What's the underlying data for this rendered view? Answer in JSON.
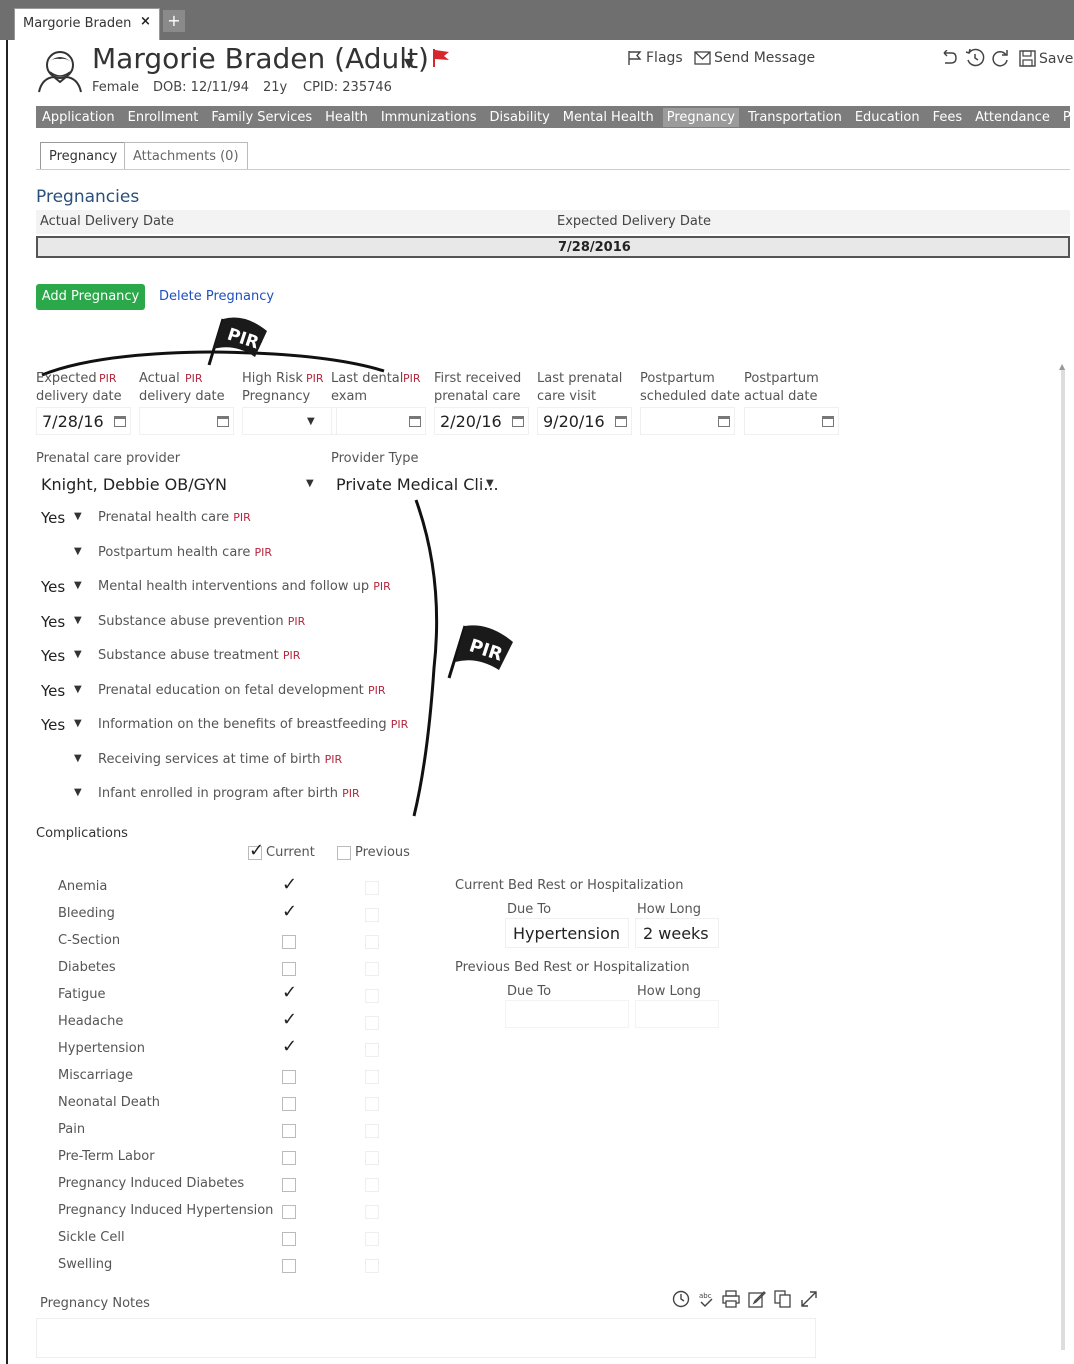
{
  "window_tab": {
    "title": "Margorie Braden",
    "close": "×",
    "add": "+"
  },
  "header": {
    "name": "Margorie Braden (Adult)",
    "gender": "Female",
    "dob": "DOB: 12/11/94",
    "age": "21y",
    "cpid": "CPID: 235746",
    "flags_label": "Flags",
    "send_message_label": "Send Message",
    "save_label": "Save",
    "flag_color": "#d7262e"
  },
  "module_nav": [
    "Application",
    "Enrollment",
    "Family Services",
    "Health",
    "Immunizations",
    "Disability",
    "Mental Health",
    "Pregnancy",
    "Transportation",
    "Education",
    "Fees",
    "Attendance",
    "PIR"
  ],
  "module_nav_active": "Pregnancy",
  "subtabs": [
    "Pregnancy",
    "Attachments (0)"
  ],
  "pregnancies": {
    "title": "Pregnancies",
    "col_actual": "Actual Delivery Date",
    "col_expected": "Expected Delivery Date",
    "row_actual": "",
    "row_expected": "7/28/2016"
  },
  "buttons": {
    "add": "Add Pregnancy",
    "delete": "Delete Pregnancy"
  },
  "pir_tag": "PIR",
  "pir_badge": "PIR",
  "fields": {
    "expected_delivery": {
      "l1": "Expected",
      "l2": "delivery date",
      "value": "7/28/16"
    },
    "actual_delivery": {
      "l1": "Actual",
      "l2": "delivery date",
      "value": ""
    },
    "high_risk": {
      "l1": "High Risk",
      "l2": "Pregnancy",
      "value": ""
    },
    "last_dental": {
      "l1": "Last dental",
      "l2": "exam",
      "value": ""
    },
    "first_prenatal": {
      "l1": "First received",
      "l2": "prenatal care",
      "value": "2/20/16"
    },
    "last_prenatal": {
      "l1": "Last prenatal",
      "l2": "care visit",
      "value": "9/20/16"
    },
    "pp_scheduled": {
      "l1": "Postpartum",
      "l2": "scheduled date",
      "value": ""
    },
    "pp_actual": {
      "l1": "Postpartum",
      "l2": "actual date",
      "value": ""
    }
  },
  "provider": {
    "label": "Prenatal care provider",
    "value": "Knight, Debbie OB/GYN",
    "type_label": "Provider Type",
    "type_value": "Private Medical Cli..."
  },
  "services": [
    {
      "value": "Yes",
      "label": "Prenatal health care"
    },
    {
      "value": "",
      "label": "Postpartum health care"
    },
    {
      "value": "Yes",
      "label": "Mental health interventions and follow up"
    },
    {
      "value": "Yes",
      "label": "Substance abuse prevention"
    },
    {
      "value": "Yes",
      "label": "Substance abuse treatment"
    },
    {
      "value": "Yes",
      "label": "Prenatal education on fetal development"
    },
    {
      "value": "Yes",
      "label": "Information on the benefits of breastfeeding"
    },
    {
      "value": "",
      "label": "Receiving services at time of birth"
    },
    {
      "value": "",
      "label": "Infant enrolled in program after birth"
    }
  ],
  "complications": {
    "title": "Complications",
    "current_label": "Current",
    "previous_label": "Previous",
    "items": [
      {
        "label": "Anemia",
        "current": true
      },
      {
        "label": "Bleeding",
        "current": true
      },
      {
        "label": "C-Section",
        "current": false
      },
      {
        "label": "Diabetes",
        "current": false
      },
      {
        "label": "Fatigue",
        "current": true
      },
      {
        "label": "Headache",
        "current": true
      },
      {
        "label": "Hypertension",
        "current": true
      },
      {
        "label": "Miscarriage",
        "current": false
      },
      {
        "label": "Neonatal Death",
        "current": false
      },
      {
        "label": "Pain",
        "current": false
      },
      {
        "label": "Pre-Term Labor",
        "current": false
      },
      {
        "label": "Pregnancy Induced Diabetes",
        "current": false
      },
      {
        "label": "Pregnancy Induced Hypertension",
        "current": false
      },
      {
        "label": "Sickle Cell",
        "current": false
      },
      {
        "label": "Swelling",
        "current": false
      }
    ]
  },
  "bed_rest": {
    "current_title": "Current Bed Rest or Hospitalization",
    "due_to": "Due To",
    "how_long": "How Long",
    "current_due": "Hypertension",
    "current_long": "2 weeks",
    "previous_title": "Previous Bed Rest or Hospitalization"
  },
  "notes": {
    "label": "Pregnancy Notes"
  }
}
